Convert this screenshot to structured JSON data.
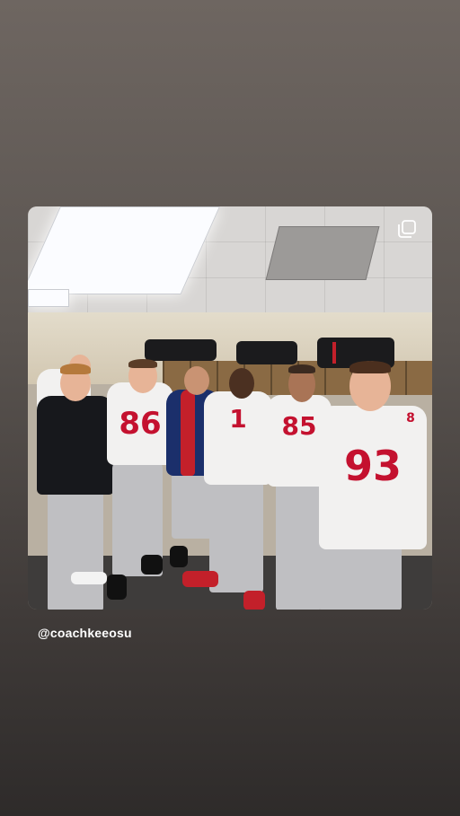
{
  "story": {
    "handle": "@coachkeeosu",
    "icons": {
      "multi_image": "multi-photo-icon"
    }
  },
  "photo": {
    "jerseys": [
      "86",
      "93",
      "85",
      "1",
      "8"
    ],
    "colors": {
      "jersey_number": "#c4112f",
      "jersey_white": "#f2f1f0",
      "pants_gray": "#bfbfc2"
    }
  }
}
